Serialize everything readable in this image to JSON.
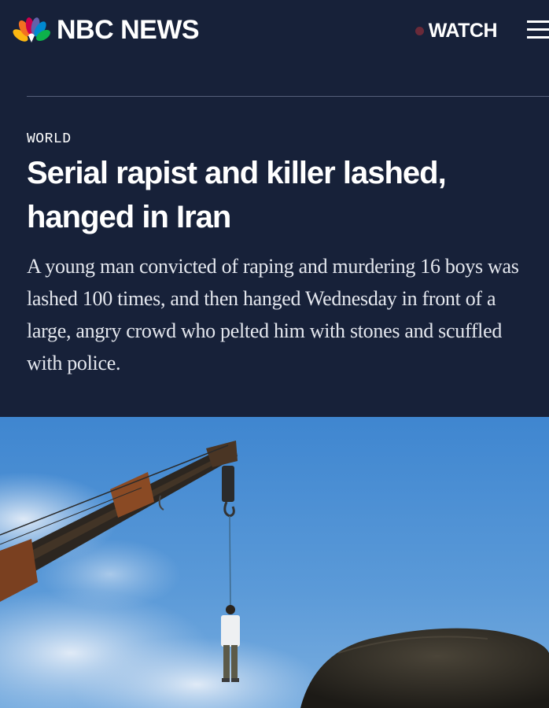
{
  "header": {
    "brand": "NBC NEWS",
    "logo_icon": "peacock-logo-icon",
    "watch_label": "WATCH",
    "menu_icon": "hamburger-menu-icon"
  },
  "article": {
    "section": "WORLD",
    "headline": "Serial rapist and killer lashed, hanged in Iran",
    "dek": "A young man convicted of raping and murdering 16 boys was lashed 100 times, and then hanged Wednesday in front of a large, angry crowd who pelted him with stones and scuffled with police."
  },
  "colors": {
    "background": "#172139",
    "text": "#ffffff",
    "watch_dot": "#6a2a39",
    "divider": "#56607a"
  }
}
